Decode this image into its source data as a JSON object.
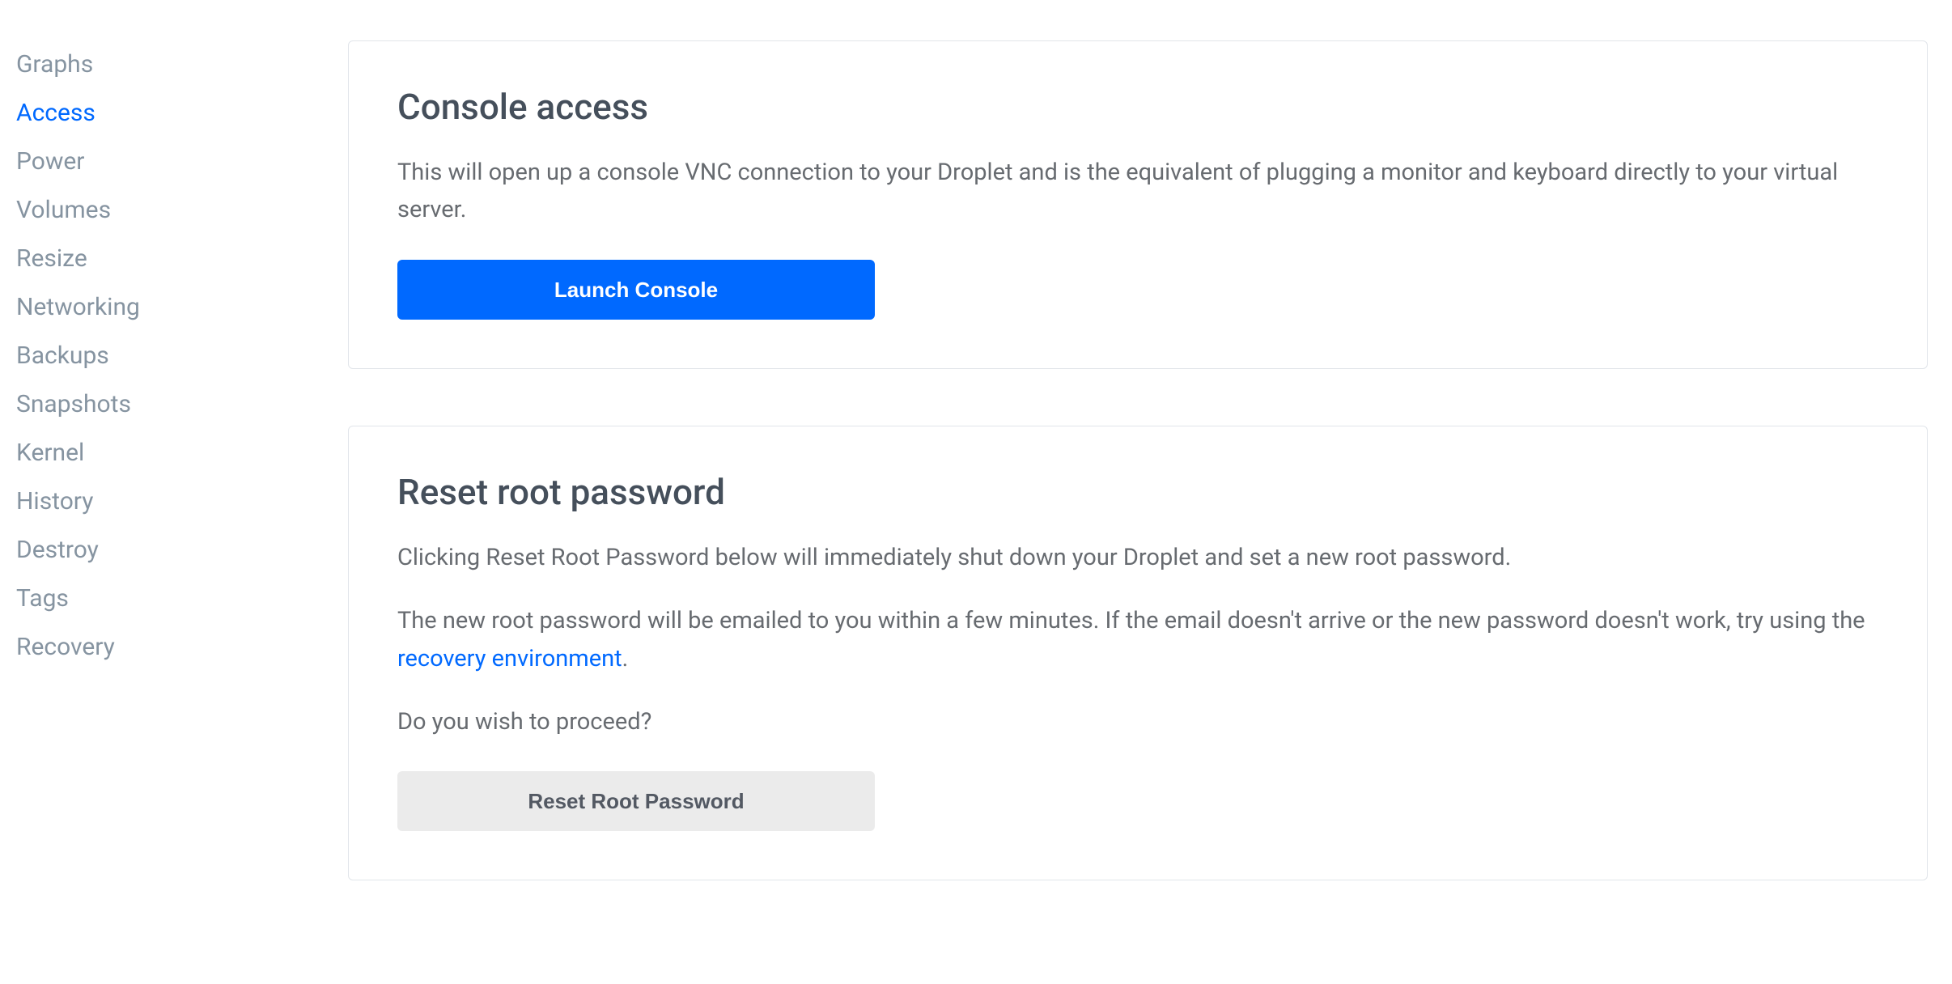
{
  "sidebar": {
    "items": [
      {
        "label": "Graphs",
        "active": false
      },
      {
        "label": "Access",
        "active": true
      },
      {
        "label": "Power",
        "active": false
      },
      {
        "label": "Volumes",
        "active": false
      },
      {
        "label": "Resize",
        "active": false
      },
      {
        "label": "Networking",
        "active": false
      },
      {
        "label": "Backups",
        "active": false
      },
      {
        "label": "Snapshots",
        "active": false
      },
      {
        "label": "Kernel",
        "active": false
      },
      {
        "label": "History",
        "active": false
      },
      {
        "label": "Destroy",
        "active": false
      },
      {
        "label": "Tags",
        "active": false
      },
      {
        "label": "Recovery",
        "active": false
      }
    ]
  },
  "console_access": {
    "title": "Console access",
    "description": "This will open up a console VNC connection to your Droplet and is the equivalent of plugging a monitor and keyboard directly to your virtual server.",
    "button_label": "Launch Console"
  },
  "reset_root_password": {
    "title": "Reset root password",
    "p1": "Clicking Reset Root Password below will immediately shut down your Droplet and set a new root password.",
    "p2_prefix": "The new root password will be emailed to you within a few minutes. If the email doesn't arrive or the new password doesn't work, try using the ",
    "p2_link": "recovery environment",
    "p2_suffix": ".",
    "p3": "Do you wish to proceed?",
    "button_label": "Reset Root Password"
  }
}
